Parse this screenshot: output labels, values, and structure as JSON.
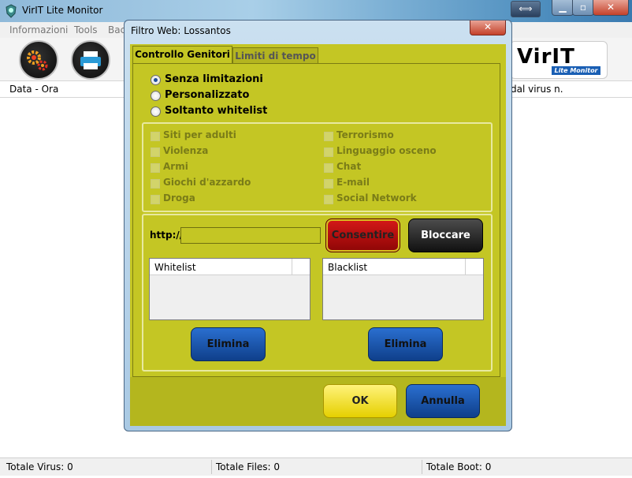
{
  "app": {
    "title": "VirIT Lite Monitor",
    "logo_text": "VirIT",
    "logo_subtitle": "Lite Monitor"
  },
  "menu": {
    "items": [
      "Informazioni",
      "Tools",
      "Bac"
    ]
  },
  "list": {
    "columns": [
      "Data - Ora",
      "dal virus n."
    ]
  },
  "status": {
    "virus": "Totale Virus: 0",
    "files": "Totale Files: 0",
    "boot": "Totale Boot: 0"
  },
  "dialog": {
    "title": "Filtro Web: Lossantos",
    "close_label": "✕",
    "tabs": [
      "Controllo Genitori",
      "Limiti di tempo"
    ],
    "modes": [
      {
        "label": "Senza limitazioni",
        "selected": true
      },
      {
        "label": "Personalizzato",
        "selected": false
      },
      {
        "label": "Soltanto whitelist",
        "selected": false
      }
    ],
    "categories_left": [
      "Siti per adulti",
      "Violenza",
      "Armi",
      "Giochi d'azzardo",
      "Droga"
    ],
    "categories_right": [
      "Terrorismo",
      "Linguaggio osceno",
      "Chat",
      "E-mail",
      "Social Network"
    ],
    "url": {
      "label": "http://",
      "value": ""
    },
    "buttons": {
      "allow": "Consentire",
      "block": "Bloccare",
      "delete": "Elimina",
      "ok": "OK",
      "cancel": "Annulla"
    },
    "lists": {
      "whitelist": "Whitelist",
      "blacklist": "Blacklist"
    }
  },
  "colors": {
    "dialog_bg": "#c4c624",
    "dialog_footer": "#b4b61e",
    "allow": "#b30f0f",
    "block": "#2a2a2a",
    "primary": "#1a56b0",
    "ok": "#f5e200"
  }
}
